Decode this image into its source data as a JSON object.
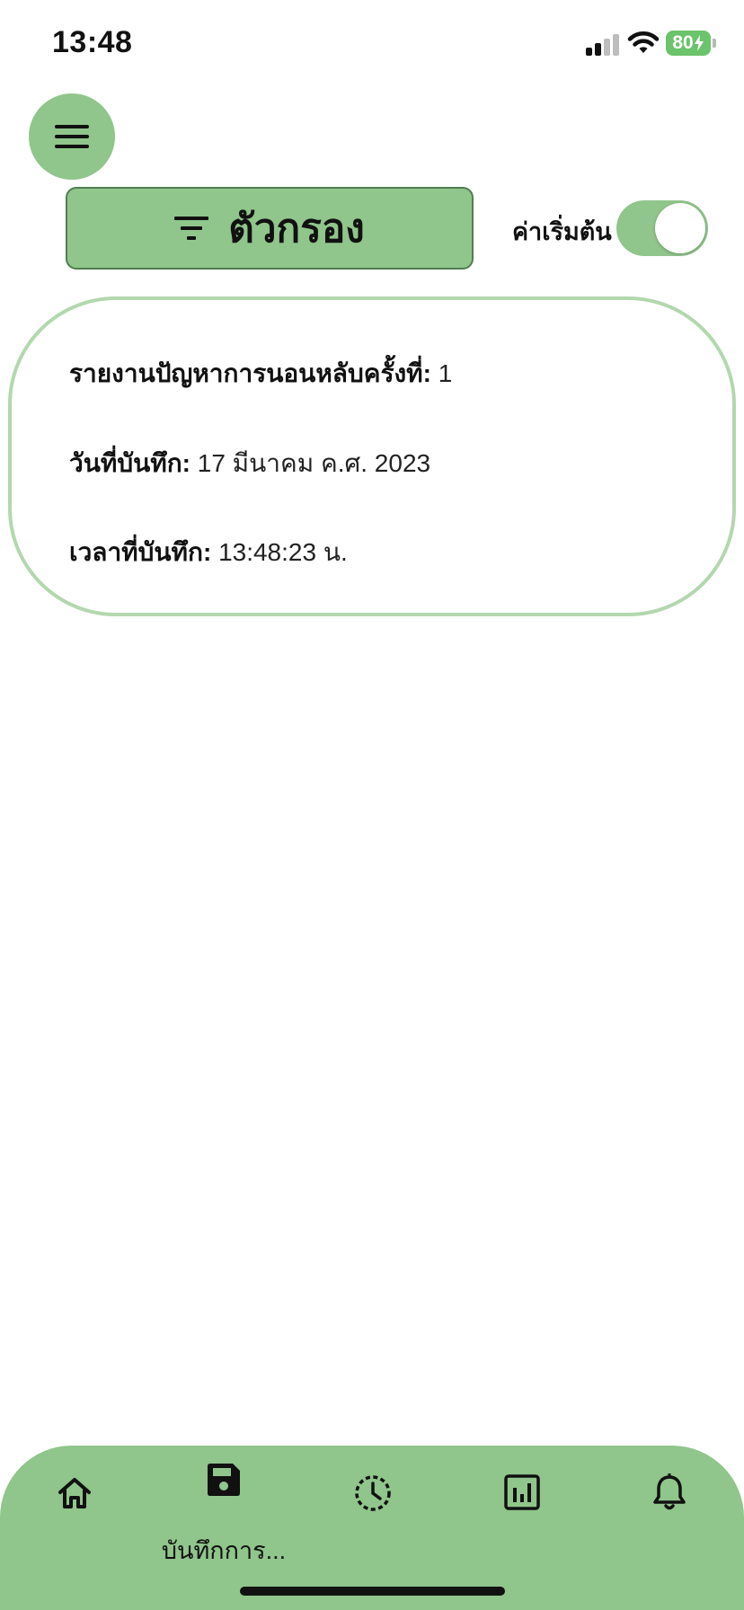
{
  "status_bar": {
    "time": "13:48",
    "battery_level": "80",
    "icons": [
      "signal-icon",
      "wifi-icon",
      "battery-charging-icon"
    ]
  },
  "header": {
    "menu_icon": "hamburger-menu-icon",
    "filter_label": "ตัวกรอง",
    "filter_icon": "filter-icon",
    "default_toggle": {
      "label": "ค่าเริ่มต้น",
      "on": true
    }
  },
  "report": {
    "title_label": "รายงานปัญหาการนอนหลับครั้งที่:",
    "title_value": "1",
    "date_label": "วันที่บันทึก:",
    "date_value": "17 มีนาคม ค.ศ. 2023",
    "time_label": "เวลาที่บันทึก:",
    "time_value": "13:48:23 น."
  },
  "bottom_nav": {
    "items": [
      {
        "icon": "home-icon",
        "label": ""
      },
      {
        "icon": "save-icon",
        "label": "บันทึกการ..."
      },
      {
        "icon": "history-clock-icon",
        "label": ""
      },
      {
        "icon": "bar-chart-icon",
        "label": ""
      },
      {
        "icon": "bell-icon",
        "label": ""
      }
    ],
    "active_index": 1
  },
  "colors": {
    "accent_green": "#90c58b",
    "card_border": "#b3d7ae",
    "battery_green": "#6bc36b"
  }
}
